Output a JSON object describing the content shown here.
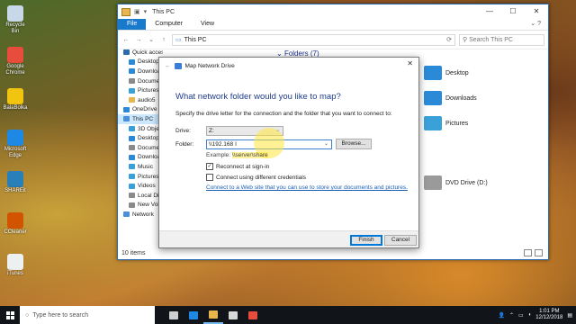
{
  "desktop_icons": [
    {
      "label": "Recycle Bin",
      "color": "#c8d8e8"
    },
    {
      "label": "Google Chrome",
      "color": "#e74c3c"
    },
    {
      "label": "BalaBolka",
      "color": "#f1c40f"
    },
    {
      "label": "Microsoft Edge",
      "color": "#1e88e5"
    },
    {
      "label": "SHAREit",
      "color": "#2980b9"
    },
    {
      "label": "CCleaner",
      "color": "#d35400"
    },
    {
      "label": "iTunes",
      "color": "#ecf0f1"
    }
  ],
  "explorer": {
    "title": "This PC",
    "ribbon_tabs": [
      "File",
      "Computer",
      "View"
    ],
    "address_path": "This PC",
    "search_placeholder": "Search This PC",
    "nav_items": [
      {
        "label": "Quick access",
        "color": "#2b6cb0"
      },
      {
        "label": "Desktop",
        "color": "#2b8ad8"
      },
      {
        "label": "Downloads",
        "color": "#2b8ad8"
      },
      {
        "label": "Documents",
        "color": "#8a8a8a"
      },
      {
        "label": "Pictures",
        "color": "#3aa0d8"
      },
      {
        "label": "audio5",
        "color": "#e8b64a"
      },
      {
        "label": "OneDrive",
        "color": "#2b8ad8"
      },
      {
        "label": "This PC",
        "color": "#4a90d9"
      },
      {
        "label": "3D Objects",
        "color": "#3aa0d8"
      },
      {
        "label": "Desktop",
        "color": "#2b8ad8"
      },
      {
        "label": "Documents",
        "color": "#8a8a8a"
      },
      {
        "label": "Downloads",
        "color": "#2b8ad8"
      },
      {
        "label": "Music",
        "color": "#3aa0d8"
      },
      {
        "label": "Pictures",
        "color": "#3aa0d8"
      },
      {
        "label": "Videos",
        "color": "#3aa0d8"
      },
      {
        "label": "Local Disk",
        "color": "#8a8a8a"
      },
      {
        "label": "New Volume",
        "color": "#8a8a8a"
      },
      {
        "label": "Network",
        "color": "#4a90d9"
      }
    ],
    "folders_header": "Folders (7)",
    "right_items": [
      {
        "label": "Desktop",
        "color": "#2b8ad8"
      },
      {
        "label": "Downloads",
        "color": "#2b8ad8"
      },
      {
        "label": "Pictures",
        "color": "#3aa0d8"
      },
      {
        "label": "DVD Drive (D:)",
        "color": "#9a9a9a"
      }
    ],
    "status": "10 items"
  },
  "dialog": {
    "title": "Map Network Drive",
    "heading": "What network folder would you like to map?",
    "instructions": "Specify the drive letter for the connection and the folder that you want to connect to:",
    "drive_label": "Drive:",
    "drive_value": "Z:",
    "folder_label": "Folder:",
    "folder_value": "\\\\192.168",
    "browse_label": "Browse...",
    "example_prefix": "Example: ",
    "example_value": "\\\\server\\share",
    "reconnect_label": "Reconnect at sign-in",
    "reconnect_checked": true,
    "different_creds_label": "Connect using different credentials",
    "different_creds_checked": false,
    "link_text": "Connect to a Web site that you can use to store your documents and pictures.",
    "finish_label": "Finish",
    "cancel_label": "Cancel"
  },
  "taskbar": {
    "search_placeholder": "Type here to search",
    "pinned": [
      {
        "name": "task-view",
        "color": "#cfcfcf"
      },
      {
        "name": "edge",
        "color": "#1e88e5"
      },
      {
        "name": "file-explorer",
        "color": "#e8b64a"
      },
      {
        "name": "store",
        "color": "#d8d8d8"
      },
      {
        "name": "chrome",
        "color": "#e74c3c"
      }
    ],
    "time": "1:01 PM",
    "date": "12/12/2018"
  }
}
